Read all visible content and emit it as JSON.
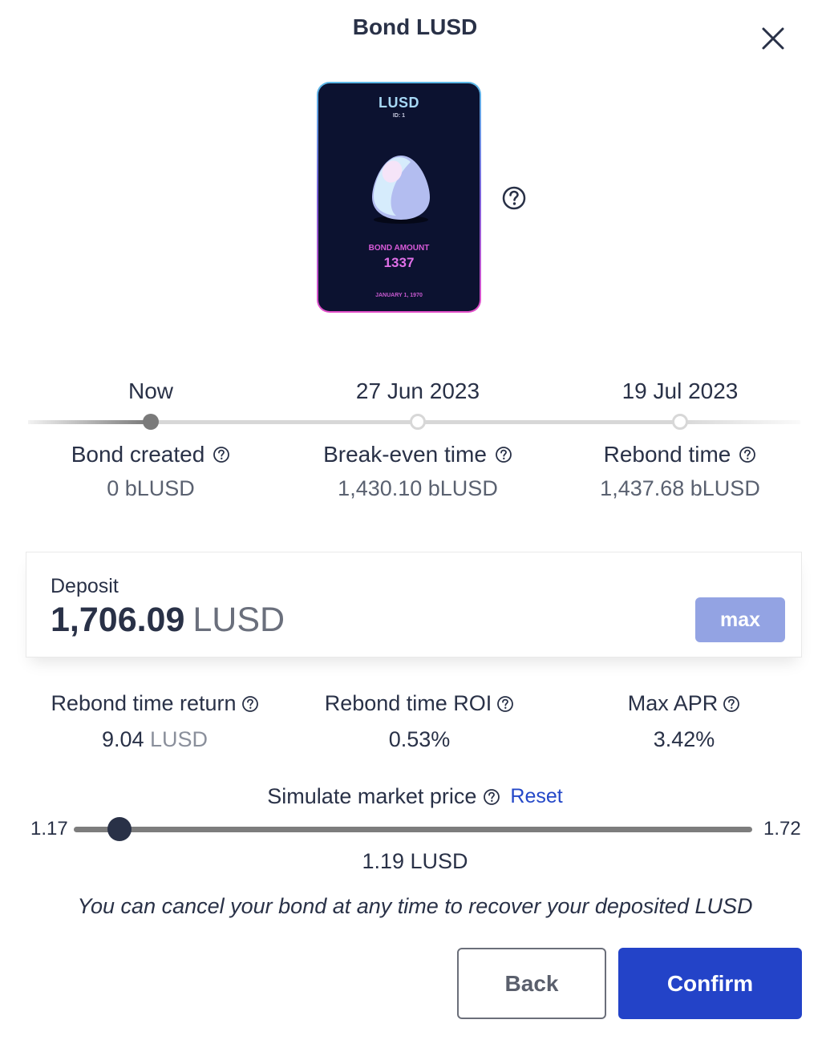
{
  "dialog": {
    "title": "Bond LUSD",
    "close_icon": "close-icon"
  },
  "nft_card": {
    "token": "LUSD",
    "id_label": "ID: 1",
    "image": "egg-icon",
    "amount_label": "BOND AMOUNT",
    "amount": "1337",
    "date": "JANUARY 1, 1970",
    "help_icon": "question-circle-icon"
  },
  "timeline": {
    "progress_fraction": 0,
    "milestones": [
      {
        "date": "Now",
        "label": "Bond created",
        "value": "0 bLUSD",
        "state": "active"
      },
      {
        "date": "27 Jun 2023",
        "label": "Break-even time",
        "value": "1,430.10 bLUSD",
        "state": "pending"
      },
      {
        "date": "19 Jul 2023",
        "label": "Rebond time",
        "value": "1,437.68 bLUSD",
        "state": "pending"
      }
    ]
  },
  "deposit": {
    "label": "Deposit",
    "amount": "1,706.09",
    "unit": "LUSD",
    "max_label": "max"
  },
  "stats": [
    {
      "label": "Rebond time return",
      "value": "9.04",
      "unit": "LUSD"
    },
    {
      "label": "Rebond time ROI",
      "value": "0.53%",
      "unit": ""
    },
    {
      "label": "Max APR",
      "value": "3.42%",
      "unit": ""
    }
  ],
  "simulate": {
    "label": "Simulate market price",
    "reset_label": "Reset",
    "min": 1.17,
    "max": 1.72,
    "min_label": "1.17",
    "max_label": "1.72",
    "value": 1.19,
    "value_label": "1.19 LUSD"
  },
  "notice": "You can cancel your bond at any time to recover your deposited LUSD",
  "actions": {
    "back_label": "Back",
    "confirm_label": "Confirm"
  },
  "colors": {
    "primary": "#2343c8",
    "text": "#293147",
    "max_button": "#93a3e3",
    "card_bg": "#0c1230",
    "card_accent": "#e070e8"
  }
}
